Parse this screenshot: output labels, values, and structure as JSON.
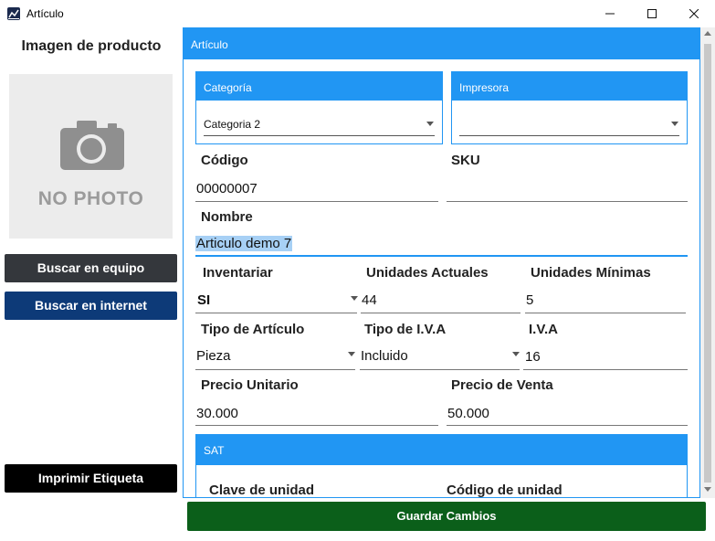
{
  "window": {
    "title": "Artículo",
    "minimize": "—",
    "maximize": "☐",
    "close": "✕"
  },
  "left": {
    "title": "Imagen de producto",
    "photo_placeholder": "NO PHOTO",
    "buttons": {
      "search_device": "Buscar en equipo",
      "search_internet": "Buscar en internet",
      "print_label": "Imprimir Etiqueta"
    }
  },
  "panel": {
    "header": "Artículo",
    "categoria": {
      "header": "Categoría",
      "value": "Categoria 2"
    },
    "impresora": {
      "header": "Impresora",
      "value": ""
    },
    "codigo": {
      "label": "Código",
      "value": "00000007"
    },
    "sku": {
      "label": "SKU",
      "value": ""
    },
    "nombre": {
      "label": "Nombre",
      "value": "Articulo demo 7"
    },
    "inventariar": {
      "label": "Inventariar",
      "value": "SI"
    },
    "unidades_actuales": {
      "label": "Unidades Actuales",
      "value": "44"
    },
    "unidades_minimas": {
      "label": "Unidades Mínimas",
      "value": "5"
    },
    "tipo_articulo": {
      "label": "Tipo de Artículo",
      "value": "Pieza"
    },
    "tipo_iva": {
      "label": "Tipo de I.V.A",
      "value": "Incluido"
    },
    "iva": {
      "label": "I.V.A",
      "value": "16"
    },
    "precio_unitario": {
      "label": "Precio Unitario",
      "value": "30.000"
    },
    "precio_venta": {
      "label": "Precio de Venta",
      "value": "50.000"
    },
    "sat": {
      "header": "SAT",
      "clave_unidad": {
        "label": "Clave de unidad"
      },
      "codigo_unidad": {
        "label": "Código de unidad"
      }
    }
  },
  "save_button": "Guardar Cambios",
  "colors": {
    "accent": "#2196f3",
    "save": "#0b5f1a",
    "dark_btn": "#34373c",
    "navy_btn": "#0d3a78",
    "black_btn": "#000000"
  }
}
